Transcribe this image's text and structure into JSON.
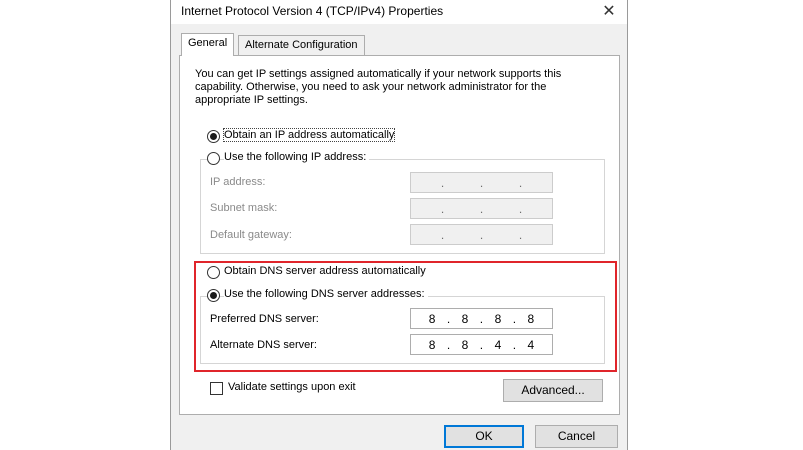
{
  "window": {
    "title": "Internet Protocol Version 4 (TCP/IPv4) Properties",
    "close_glyph": "✕"
  },
  "tabs": [
    {
      "label": "General",
      "active": true
    },
    {
      "label": "Alternate Configuration",
      "active": false
    }
  ],
  "general": {
    "description": "You can get IP settings assigned automatically if your network supports this capability. Otherwise, you need to ask your network administrator for the appropriate IP settings.",
    "ip_auto_radio": {
      "label": "Obtain an IP address automatically",
      "checked": true
    },
    "ip_manual_radio": {
      "label": "Use the following IP address:",
      "checked": false
    },
    "ip_address": {
      "label": "IP address:",
      "value": [
        ".",
        ".",
        "."
      ]
    },
    "subnet_mask": {
      "label": "Subnet mask:",
      "value": [
        ".",
        ".",
        "."
      ]
    },
    "default_gateway": {
      "label": "Default gateway:",
      "value": [
        ".",
        ".",
        "."
      ]
    },
    "dns_auto_radio": {
      "label": "Obtain DNS server address automatically",
      "checked": false
    },
    "dns_manual_radio": {
      "label": "Use the following DNS server addresses:",
      "checked": true
    },
    "preferred_dns": {
      "label": "Preferred DNS server:",
      "octets": [
        "8",
        ".",
        "8",
        ".",
        "8",
        ".",
        "8"
      ]
    },
    "alternate_dns": {
      "label": "Alternate DNS server:",
      "octets": [
        "8",
        ".",
        "8",
        ".",
        "4",
        ".",
        "4"
      ]
    },
    "validate_checkbox": {
      "label": "Validate settings upon exit",
      "checked": false
    },
    "advanced_button": "Advanced..."
  },
  "footer": {
    "ok_button": "OK",
    "cancel_button": "Cancel"
  },
  "colors": {
    "highlight": "#e0252b",
    "default_button_border": "#0078d7"
  }
}
